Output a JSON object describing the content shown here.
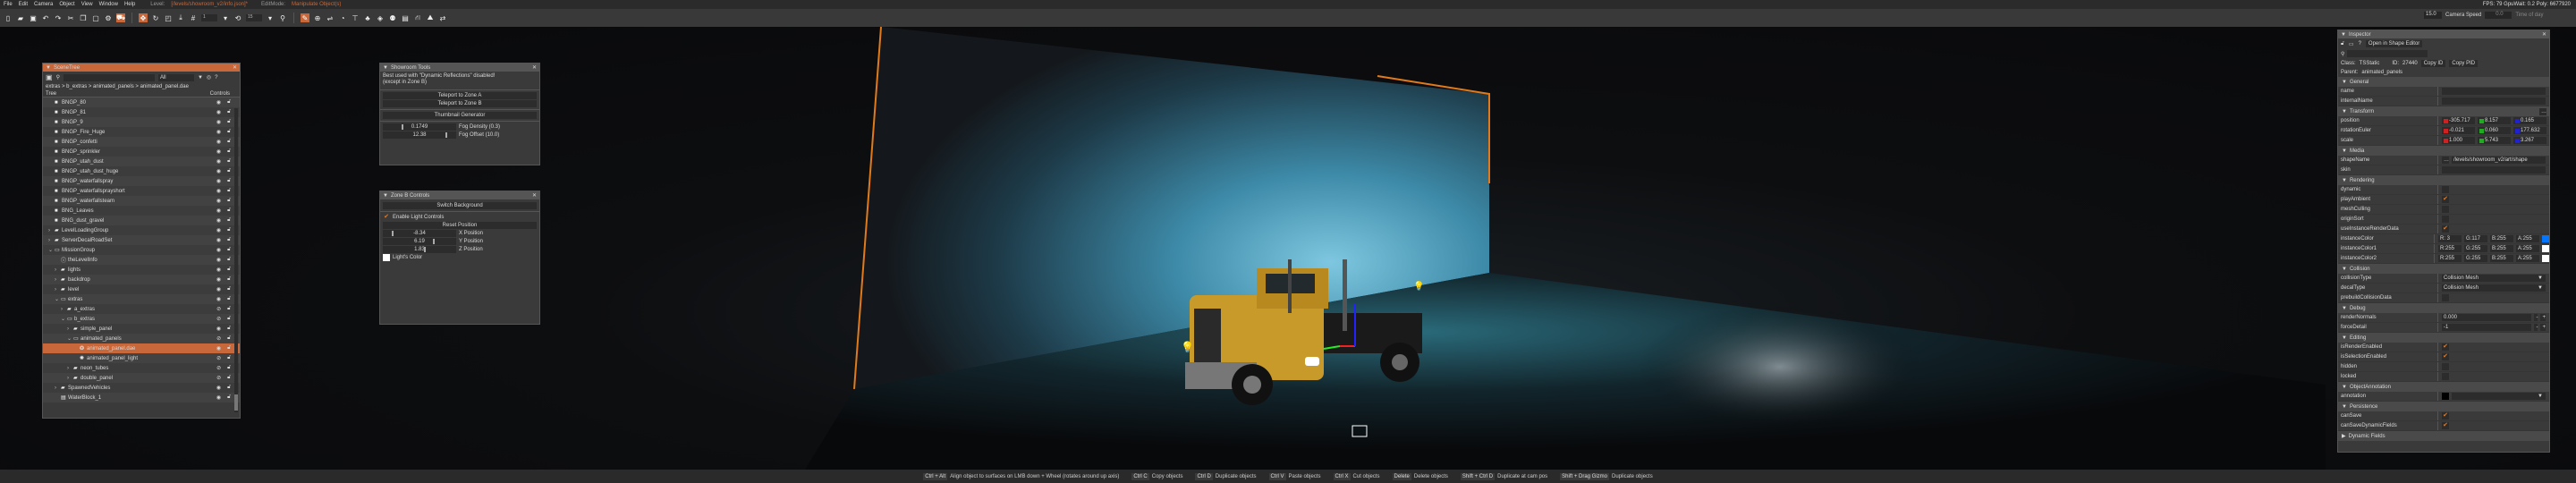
{
  "menu": {
    "items": [
      "File",
      "Edit",
      "Camera",
      "Object",
      "View",
      "Window",
      "Help"
    ],
    "level_label": "Level:",
    "level_value": "[/levels/showroom_v2/info.json]*",
    "editmode_label": "EditMode:",
    "editmode_value": "Manipulate Object(s)",
    "stats": "FPS: 79  GpuWait: 0.2  Poly: 6677920"
  },
  "toolbar": {
    "snap_value": "1",
    "rot_snap_value": "15",
    "camera_speed_value": "15.0",
    "camera_speed_label": "Camera Speed",
    "time_of_day_value": "0.0",
    "time_of_day_label": "Time of day"
  },
  "scene_tree": {
    "title": "SceneTree",
    "filter": "All",
    "breadcrumb": "extras  >  b_extras  >  animated_panels  >  animated_panel.dae",
    "col_tree": "Tree",
    "col_controls": "Controls",
    "rows": [
      {
        "label": "BNGP_80",
        "depth": 0,
        "icon": "square",
        "chev": "",
        "hidden": false
      },
      {
        "label": "BNGP_81",
        "depth": 0,
        "icon": "square",
        "chev": "",
        "hidden": false
      },
      {
        "label": "BNGP_9",
        "depth": 0,
        "icon": "square",
        "chev": "",
        "hidden": false
      },
      {
        "label": "BNGP_Fire_Huge",
        "depth": 0,
        "icon": "square",
        "chev": "",
        "hidden": false
      },
      {
        "label": "BNGP_confetti",
        "depth": 0,
        "icon": "square",
        "chev": "",
        "hidden": false
      },
      {
        "label": "BNGP_sprinkler",
        "depth": 0,
        "icon": "square",
        "chev": "",
        "hidden": false
      },
      {
        "label": "BNGP_utah_dust",
        "depth": 0,
        "icon": "square",
        "chev": "",
        "hidden": false
      },
      {
        "label": "BNGP_utah_dust_huge",
        "depth": 0,
        "icon": "square",
        "chev": "",
        "hidden": false
      },
      {
        "label": "BNGP_waterfallspray",
        "depth": 0,
        "icon": "square",
        "chev": "",
        "hidden": false
      },
      {
        "label": "BNGP_waterfallsprayshort",
        "depth": 0,
        "icon": "square",
        "chev": "",
        "hidden": false
      },
      {
        "label": "BNGP_waterfallsteam",
        "depth": 0,
        "icon": "square",
        "chev": "",
        "hidden": false
      },
      {
        "label": "BNG_Leaves",
        "depth": 0,
        "icon": "square",
        "chev": "",
        "hidden": false
      },
      {
        "label": "BNG_dust_gravel",
        "depth": 0,
        "icon": "square",
        "chev": "",
        "hidden": false
      },
      {
        "label": "LevelLoadingGroup",
        "depth": 0,
        "icon": "folder",
        "chev": "›",
        "hidden": false
      },
      {
        "label": "ServerDecalRoadSet",
        "depth": 0,
        "icon": "folder",
        "chev": "›",
        "hidden": false
      },
      {
        "label": "MissionGroup",
        "depth": 0,
        "icon": "folder-open",
        "chev": "⌄",
        "hidden": false
      },
      {
        "label": "theLevelInfo",
        "depth": 1,
        "icon": "info",
        "chev": "",
        "hidden": false
      },
      {
        "label": "lights",
        "depth": 1,
        "icon": "folder",
        "chev": "›",
        "hidden": false
      },
      {
        "label": "backdrop",
        "depth": 1,
        "icon": "folder",
        "chev": "›",
        "hidden": false
      },
      {
        "label": "level",
        "depth": 1,
        "icon": "folder",
        "chev": "›",
        "hidden": false
      },
      {
        "label": "extras",
        "depth": 1,
        "icon": "folder-open",
        "chev": "⌄",
        "hidden": false
      },
      {
        "label": "a_extras",
        "depth": 2,
        "icon": "folder",
        "chev": "›",
        "hidden": true
      },
      {
        "label": "b_extras",
        "depth": 2,
        "icon": "folder-open",
        "chev": "⌄",
        "hidden": true
      },
      {
        "label": "simple_panel",
        "depth": 3,
        "icon": "folder",
        "chev": "›",
        "hidden": false
      },
      {
        "label": "animated_panels",
        "depth": 3,
        "icon": "folder-open",
        "chev": "⌄",
        "hidden": true
      },
      {
        "label": "animated_panel.dae",
        "depth": 4,
        "icon": "mesh",
        "chev": "",
        "hidden": false,
        "selected": true
      },
      {
        "label": "animated_panel_light",
        "depth": 4,
        "icon": "light",
        "chev": "",
        "hidden": true
      },
      {
        "label": "neon_tubes",
        "depth": 3,
        "icon": "folder",
        "chev": "›",
        "hidden": true
      },
      {
        "label": "double_panel",
        "depth": 3,
        "icon": "folder",
        "chev": "›",
        "hidden": true
      },
      {
        "label": "SpawnedVehicles",
        "depth": 1,
        "icon": "folder",
        "chev": "›",
        "hidden": false
      },
      {
        "label": "WaterBlock_1",
        "depth": 1,
        "icon": "water",
        "chev": "",
        "hidden": false
      }
    ]
  },
  "showroom_tools": {
    "title": "Showroom Tools",
    "note1": "Best used with \"Dynamic Reflections\" disabled!",
    "note2": "(except in Zone B)",
    "teleport_a": "Teleport to Zone A",
    "teleport_b": "Teleport to Zone B",
    "thumbnail": "Thumbnail Generator",
    "fog_density_value": "0.1749",
    "fog_density_label": "Fog Density (0.3)",
    "fog_offset_value": "12.38",
    "fog_offset_label": "Fog Offset (10.0)"
  },
  "zone_b": {
    "title": "Zone B Controls",
    "switch_bg": "Switch Background",
    "enable_lights": "Enable Light Controls",
    "enable_lights_checked": true,
    "reset": "Reset Position",
    "x_value": "-8.34",
    "x_label": "X Position",
    "y_value": "6.19",
    "y_label": "Y Position",
    "z_value": "1.83",
    "z_label": "Z Position",
    "color_label": "Light's Color"
  },
  "inspector": {
    "title": "Inspector",
    "open_shape_editor": "Open in Shape Editor",
    "class_label": "Class:",
    "class_value": "TSStatic",
    "id_label": "ID:",
    "id_value": "27440",
    "copy_id": "Copy ID",
    "copy_pid": "Copy PID",
    "parent_label": "Parent:",
    "parent_value": "animated_panels",
    "sections": [
      {
        "title": "General",
        "rows": [
          {
            "label": "name",
            "type": "text",
            "value": ""
          },
          {
            "label": "internalName",
            "type": "text",
            "value": ""
          }
        ]
      },
      {
        "title": "Transform",
        "rows": [
          {
            "label": "position",
            "type": "xyz",
            "values": [
              "-305.717",
              "8.157",
              "0.165"
            ]
          },
          {
            "label": "rotationEuler",
            "type": "xyz",
            "values": [
              "-0.021",
              "0.060",
              "177.632"
            ]
          },
          {
            "label": "scale",
            "type": "xyz",
            "values": [
              "1.000",
              "5.743",
              "3.267"
            ]
          }
        ]
      },
      {
        "title": "Media",
        "rows": [
          {
            "label": "shapeName",
            "type": "text",
            "value": "/levels/showroom_v2/art/shape"
          },
          {
            "label": "skin",
            "type": "text",
            "value": ""
          }
        ]
      },
      {
        "title": "Rendering",
        "rows": [
          {
            "label": "dynamic",
            "type": "check",
            "checked": false
          },
          {
            "label": "playAmbient",
            "type": "check",
            "checked": true
          },
          {
            "label": "meshCulling",
            "type": "check",
            "checked": false
          },
          {
            "label": "originSort",
            "type": "check",
            "checked": false
          },
          {
            "label": "useInstanceRenderData",
            "type": "check",
            "checked": true
          },
          {
            "label": "instanceColor",
            "type": "color",
            "values": [
              "R:  3",
              "G:117",
              "B:255",
              "A:255"
            ],
            "swatch": "#0375ff"
          },
          {
            "label": "instanceColor1",
            "type": "color",
            "values": [
              "R:255",
              "G:255",
              "B:255",
              "A:255"
            ],
            "swatch": "#ffffff"
          },
          {
            "label": "instanceColor2",
            "type": "color",
            "values": [
              "R:255",
              "G:255",
              "B:255",
              "A:255"
            ],
            "swatch": "#ffffff"
          }
        ]
      },
      {
        "title": "Collision",
        "rows": [
          {
            "label": "collisionType",
            "type": "select",
            "value": "Collision Mesh"
          },
          {
            "label": "decalType",
            "type": "select",
            "value": "Collision Mesh"
          },
          {
            "label": "prebuildCollisionData",
            "type": "check",
            "checked": false
          }
        ]
      },
      {
        "title": "Debug",
        "rows": [
          {
            "label": "renderNormals",
            "type": "stepper",
            "value": "0.000"
          },
          {
            "label": "forceDetail",
            "type": "stepper",
            "value": "-1"
          }
        ]
      },
      {
        "title": "Editing",
        "rows": [
          {
            "label": "isRenderEnabled",
            "type": "check",
            "checked": true
          },
          {
            "label": "isSelectionEnabled",
            "type": "check",
            "checked": true
          },
          {
            "label": "hidden",
            "type": "check",
            "checked": false
          },
          {
            "label": "locked",
            "type": "check",
            "checked": false
          }
        ]
      },
      {
        "title": "ObjectAnnotation",
        "rows": [
          {
            "label": "annotation",
            "type": "select",
            "value": "",
            "swatch": "#000000"
          }
        ]
      },
      {
        "title": "Persistence",
        "rows": [
          {
            "label": "canSave",
            "type": "check",
            "checked": true
          },
          {
            "label": "canSaveDynamicFields",
            "type": "check",
            "checked": true
          }
        ]
      },
      {
        "title": "Dynamic Fields",
        "collapsed": true,
        "rows": []
      }
    ]
  },
  "status": [
    {
      "key": "Ctrl + Alt",
      "desc": "Align object to surfaces on LMB down + Wheel (rotates around up axis)"
    },
    {
      "key": "Ctrl C",
      "desc": "Copy objects"
    },
    {
      "key": "Ctrl D",
      "desc": "Duplicate objects"
    },
    {
      "key": "Ctrl V",
      "desc": "Paste objects"
    },
    {
      "key": "Ctrl X",
      "desc": "Cut objects"
    },
    {
      "key": "Delete",
      "desc": "Delete objects"
    },
    {
      "key": "Shift + Ctrl D",
      "desc": "Duplicate at cam pos"
    },
    {
      "key": "Shift + Drag Gizmo",
      "desc": "Duplicate objects"
    }
  ],
  "colors": {
    "accent": "#c8683a",
    "check": "#e07a2a"
  }
}
